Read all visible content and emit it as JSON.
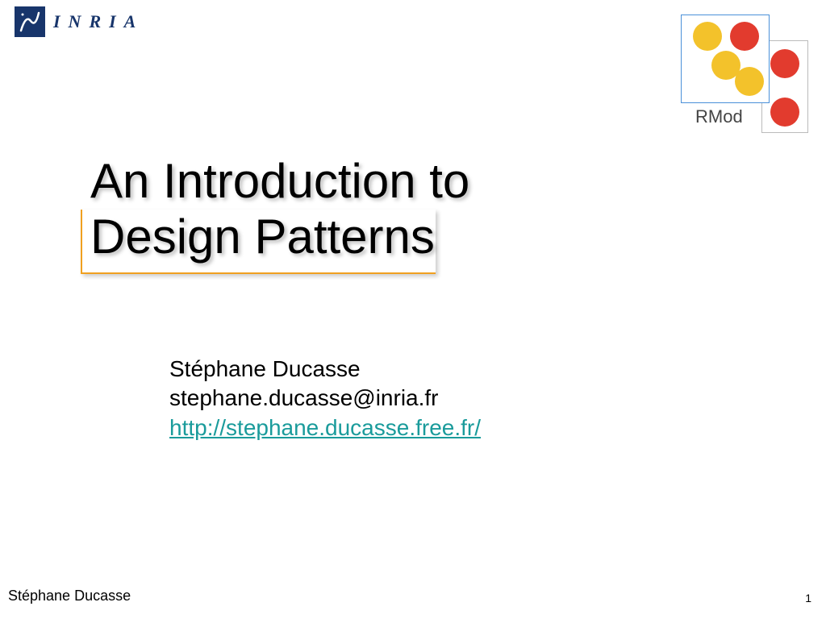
{
  "header": {
    "inria_text": "INRIA",
    "rmod_label": "RMod"
  },
  "title": {
    "line1": "An Introduction to",
    "line2": "Design Patterns"
  },
  "author": {
    "name": "Stéphane Ducasse",
    "email": "stephane.ducasse@inria.fr",
    "url": "http://stephane.ducasse.free.fr/"
  },
  "footer": {
    "name": "Stéphane Ducasse",
    "page": "1"
  }
}
